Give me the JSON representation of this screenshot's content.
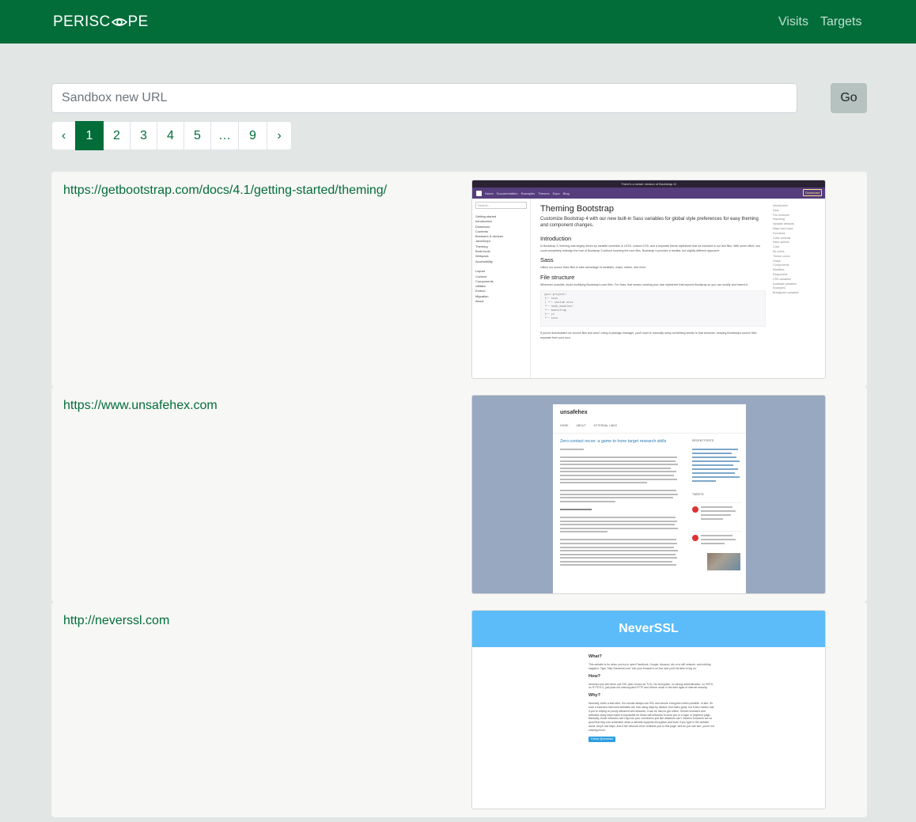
{
  "navbar": {
    "brand_prefix": "PERISC",
    "brand_suffix": "PE",
    "links": [
      {
        "label": "Visits"
      },
      {
        "label": "Targets"
      }
    ],
    "colors": {
      "background": "#036d3a",
      "link": "#bfe0cf"
    }
  },
  "search": {
    "placeholder": "Sandbox new URL",
    "go_label": "Go"
  },
  "pagination": {
    "prev": "‹",
    "next": "›",
    "pages": [
      "1",
      "2",
      "3",
      "4",
      "5",
      "…",
      "9"
    ],
    "active": "1"
  },
  "visits": [
    {
      "url": "https://getbootstrap.com/docs/4.1/getting-started/theming/",
      "screenshot": {
        "banner": "There's a newer version of Bootstrap 4!",
        "nav": [
          "Home",
          "Documentation",
          "Examples",
          "Themes",
          "Expo",
          "Blog"
        ],
        "download": "Download",
        "search_placeholder": "Search...",
        "sidebar": [
          "Getting started",
          "Introduction",
          "Download",
          "Contents",
          "Browsers & devices",
          "JavaScript",
          "Theming",
          "Build tools",
          "Webpack",
          "Accessibility",
          "",
          "Layout",
          "Content",
          "Components",
          "Utilities",
          "Extend",
          "Migration",
          "About"
        ],
        "title": "Theming Bootstrap",
        "lead": "Customize Bootstrap 4 with our new built-in Sass variables for global style preferences for easy theming and component changes.",
        "sections": [
          {
            "heading": "Introduction",
            "text": "In Bootstrap 3, theming was largely driven by variable overrides in LESS, custom CSS, and a separate theme stylesheet that we included in our dist files. With some effort, one could completely redesign the look of Bootstrap 3 without touching the core files. Bootstrap 4 provides a familiar, but slightly different approach."
          },
          {
            "heading": "Sass",
            "text": "Utilize our source Sass files to take advantage of variables, maps, mixins, and more."
          },
          {
            "heading": "File structure",
            "text": "Whenever possible, avoid modifying Bootstrap's core files. For Sass, that means creating your own stylesheet that imports Bootstrap so you can modify and extend it."
          }
        ],
        "code": [
          "your-project/",
          "├── scss",
          "│   └── custom.scss",
          "└── node_modules/",
          "    └── bootstrap",
          "        ├── js",
          "        └── scss"
        ],
        "after_code": "If you've downloaded our source files and aren't using a package manager, you'll want to manually setup something similar to that structure, keeping Bootstrap's source files separate from your own.",
        "toc": [
          "Introduction",
          "Sass",
          "File structure",
          "Importing",
          "Variable defaults",
          "Maps and loops",
          "Functions",
          "Color contrast",
          "Sass options",
          "Color",
          "All colors",
          "Theme colors",
          "Grays",
          "Components",
          "Modifiers",
          "Responsive",
          "CSS variables",
          "Available variables",
          "Examples",
          "Breakpoint variables"
        ]
      }
    },
    {
      "url": "https://www.unsafehex.com",
      "screenshot": {
        "site_title": "unsafehex",
        "menu": [
          "HOME",
          "ABOUT",
          "EXTERNAL LINKS"
        ],
        "post_title": "Zero-contact recon: a game to hone target research skills",
        "sidebar_heading": "RECENT POSTS",
        "tweets_heading": "TWEETS"
      }
    },
    {
      "url": "http://neverssl.com",
      "screenshot": {
        "header": "NeverSSL",
        "sections": [
          {
            "heading": "What?",
            "text": "This website is for when you try to open Facebook, Google, Amazon, etc on a wifi network, and nothing happens. Type \"http://neverssl.com\" into your browser's url bar, and you'll be able to log on."
          },
          {
            "heading": "How?",
            "text": "neverssl.com will never use SSL (also known as TLS). No encryption, no strong authentication, no HSTS, no HTTP/2.0, just plain old unencrypted HTTP and forever stuck in the dark ages of internet security."
          },
          {
            "heading": "Why?",
            "text": "Normally, that's a bad idea. You should always use SSL and secure encryption when possible. In fact, it's such a bad idea that most websites are now using https by default. And that's great, but it also means that if you're relying on poorly-behaved wifi networks, it can be hard to get online. Secure browsers and websites using https make it impossible for those wifi networks to send you to a login or payment page. Basically, those networks can't tap into your connection just like attackers can't. Modern browsers are so good that they can remember when a website supports encryption and even if you type in the website name, they'll use https. And if the network never redirects you to this page, well as you can see, you're not missing much."
          }
        ],
        "follow": "Follow @neverssl"
      }
    }
  ]
}
